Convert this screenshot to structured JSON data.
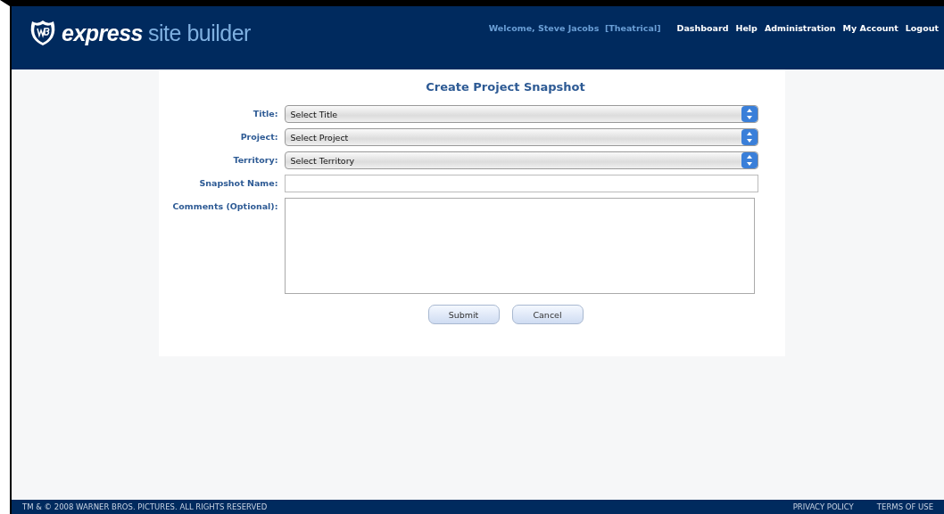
{
  "header": {
    "logo": {
      "bold": "express",
      "light": "site builder"
    },
    "welcome": "Welcome, Steve Jacobs  [Theatrical]",
    "nav": [
      "Dashboard",
      "Help",
      "Administration",
      "My Account",
      "Logout"
    ]
  },
  "form": {
    "title": "Create Project Snapshot",
    "fields": [
      {
        "kind": "select",
        "label": "Title:",
        "value": "Select Title"
      },
      {
        "kind": "select",
        "label": "Project:",
        "value": "Select Project"
      },
      {
        "kind": "select",
        "label": "Territory:",
        "value": "Select Territory"
      },
      {
        "kind": "text",
        "label": "Snapshot Name:"
      },
      {
        "kind": "textarea",
        "label": "Comments (Optional):"
      }
    ],
    "buttons": [
      "Submit",
      "Cancel"
    ]
  },
  "footer": {
    "copyright": "TM & © 2008 WARNER BROS. PICTURES. ALL RIGHTS RESERVED",
    "links": [
      "PRIVACY POLICY",
      "TERMS OF USE"
    ]
  }
}
